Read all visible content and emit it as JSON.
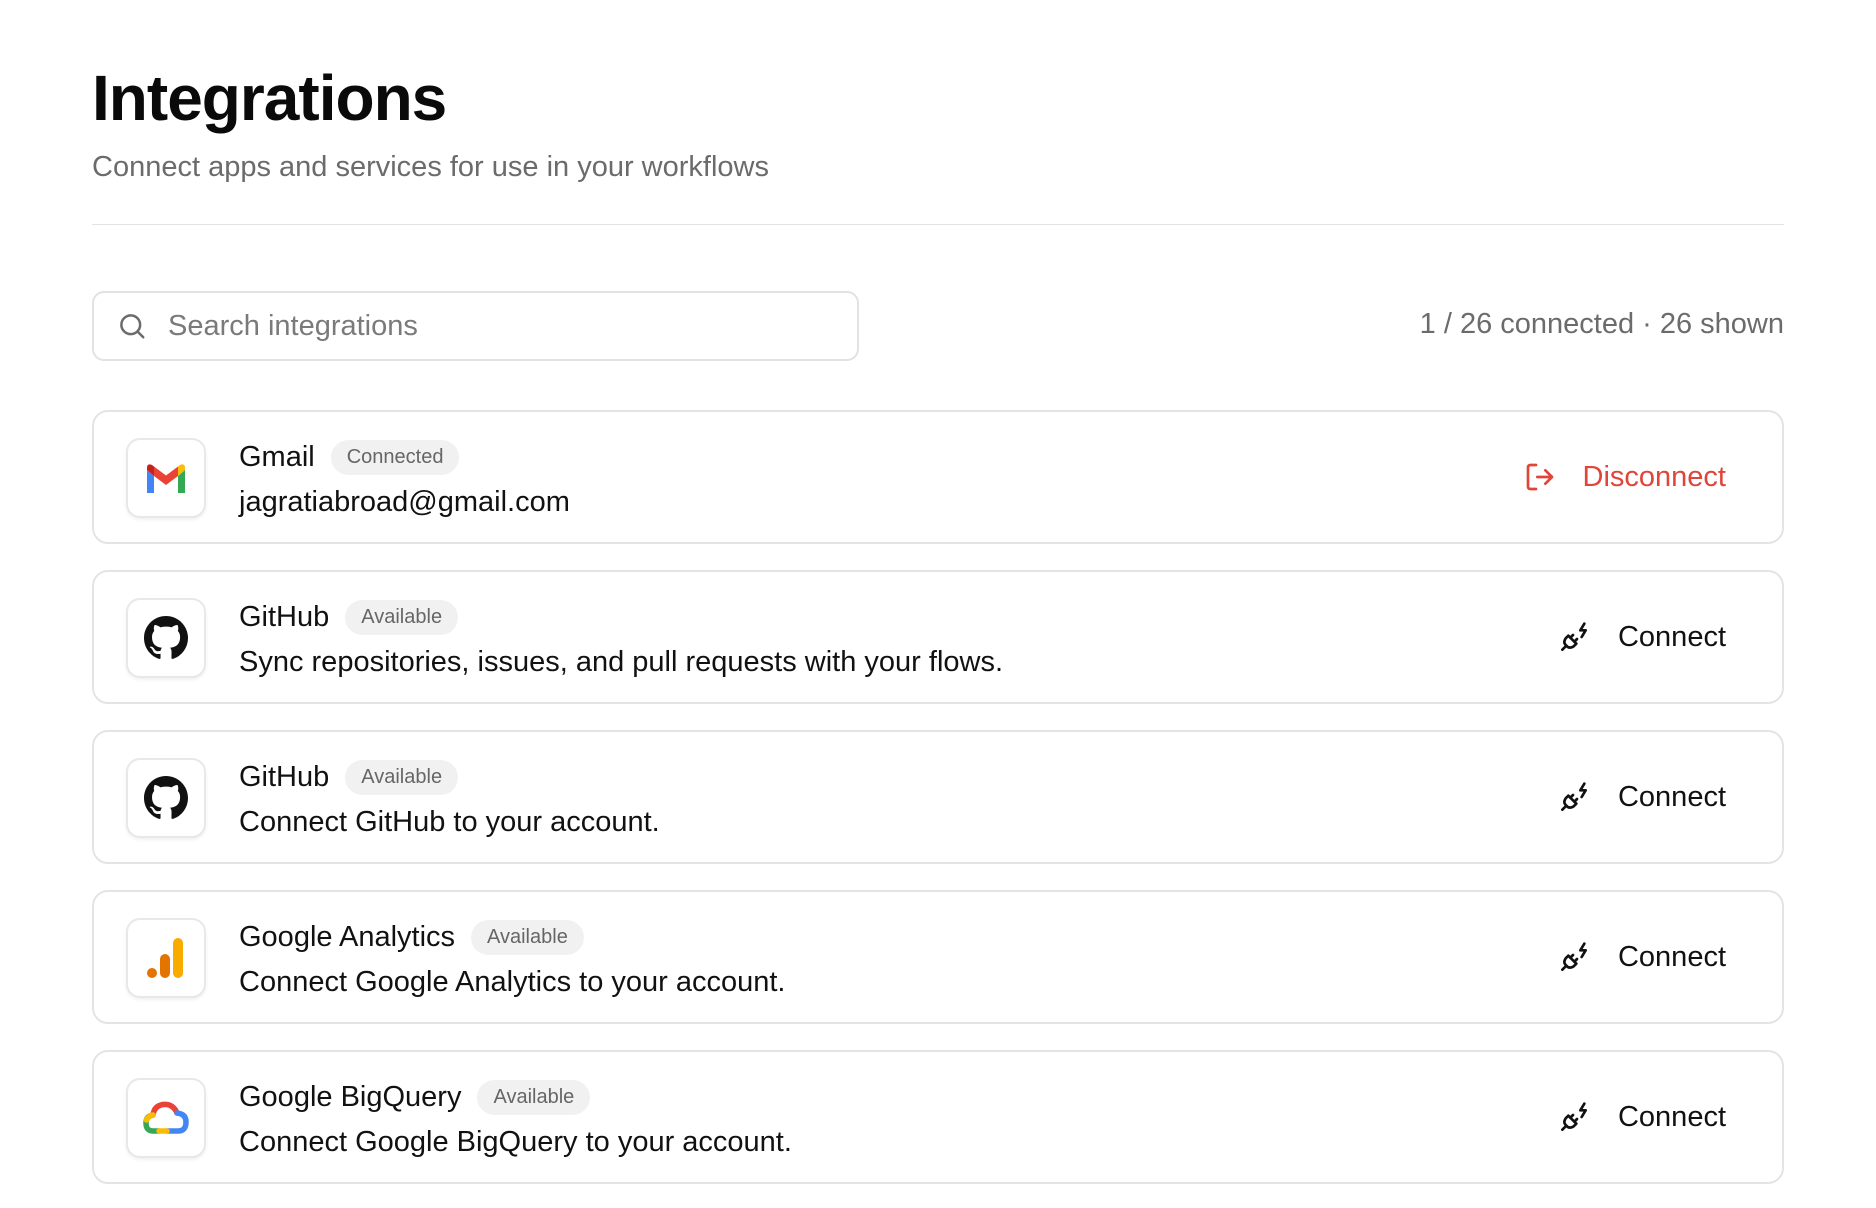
{
  "header": {
    "title": "Integrations",
    "subtitle": "Connect apps and services for use in your workflows"
  },
  "search": {
    "placeholder": "Search integrations",
    "value": ""
  },
  "summary": {
    "text": "1 / 26 connected · 26 shown"
  },
  "colors": {
    "danger": "#e0453a",
    "badge_bg": "#f1f1f1",
    "border": "#e4e4e4"
  },
  "integrations": [
    {
      "name": "Gmail",
      "status": "Connected",
      "description": "jagratiabroad@gmail.com",
      "action": "Disconnect",
      "icon": "gmail-logo-icon"
    },
    {
      "name": "GitHub",
      "status": "Available",
      "description": "Sync repositories, issues, and pull requests with your flows.",
      "action": "Connect",
      "icon": "github-logo-icon"
    },
    {
      "name": "GitHub",
      "status": "Available",
      "description": "Connect GitHub to your account.",
      "action": "Connect",
      "icon": "github-logo-icon"
    },
    {
      "name": "Google Analytics",
      "status": "Available",
      "description": "Connect Google Analytics to your account.",
      "action": "Connect",
      "icon": "google-analytics-logo-icon"
    },
    {
      "name": "Google BigQuery",
      "status": "Available",
      "description": "Connect Google BigQuery to your account.",
      "action": "Connect",
      "icon": "google-cloud-logo-icon"
    }
  ]
}
